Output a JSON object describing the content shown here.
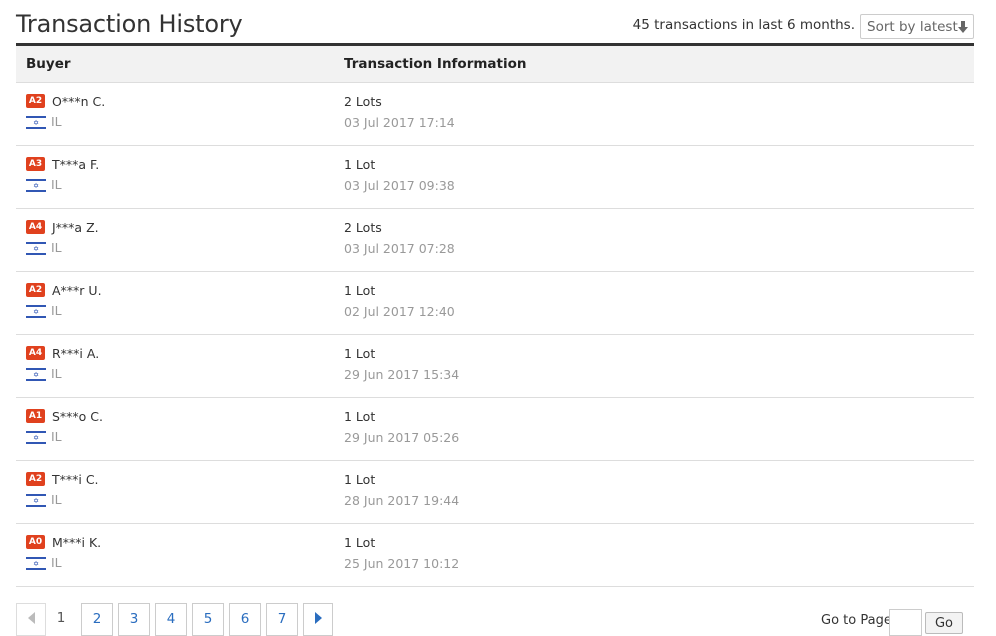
{
  "header": {
    "title": "Transaction History",
    "summary": "45 transactions in last 6 months.",
    "sort_label": "Sort by latest"
  },
  "table": {
    "columns": [
      "Buyer",
      "Transaction Information"
    ],
    "rows": [
      {
        "level": "A2",
        "buyer": "O***n C.",
        "country": "IL",
        "lots": "2 Lots",
        "date": "03 Jul 2017 17:14"
      },
      {
        "level": "A3",
        "buyer": "T***a F.",
        "country": "IL",
        "lots": "1 Lot",
        "date": "03 Jul 2017 09:38"
      },
      {
        "level": "A4",
        "buyer": "J***a Z.",
        "country": "IL",
        "lots": "2 Lots",
        "date": "03 Jul 2017 07:28"
      },
      {
        "level": "A2",
        "buyer": "A***r U.",
        "country": "IL",
        "lots": "1 Lot",
        "date": "02 Jul 2017 12:40"
      },
      {
        "level": "A4",
        "buyer": "R***i A.",
        "country": "IL",
        "lots": "1 Lot",
        "date": "29 Jun 2017 15:34"
      },
      {
        "level": "A1",
        "buyer": "S***o C.",
        "country": "IL",
        "lots": "1 Lot",
        "date": "29 Jun 2017 05:26"
      },
      {
        "level": "A2",
        "buyer": "T***i C.",
        "country": "IL",
        "lots": "1 Lot",
        "date": "28 Jun 2017 19:44"
      },
      {
        "level": "A0",
        "buyer": "M***i K.",
        "country": "IL",
        "lots": "1 Lot",
        "date": "25 Jun 2017 10:12"
      }
    ]
  },
  "pagination": {
    "current": "1",
    "pages": [
      "2",
      "3",
      "4",
      "5",
      "6",
      "7"
    ],
    "goto_label": "Go to Page",
    "goto_value": "",
    "go_button": "Go"
  },
  "colors": {
    "badge": "#e0411e",
    "link": "#2a6dbf",
    "flag_blue": "#3157b4"
  },
  "icons": {
    "sort": "arrow-down-icon",
    "prev": "chevron-left-icon",
    "next": "chevron-right-icon",
    "flag": "israel-flag-icon"
  }
}
